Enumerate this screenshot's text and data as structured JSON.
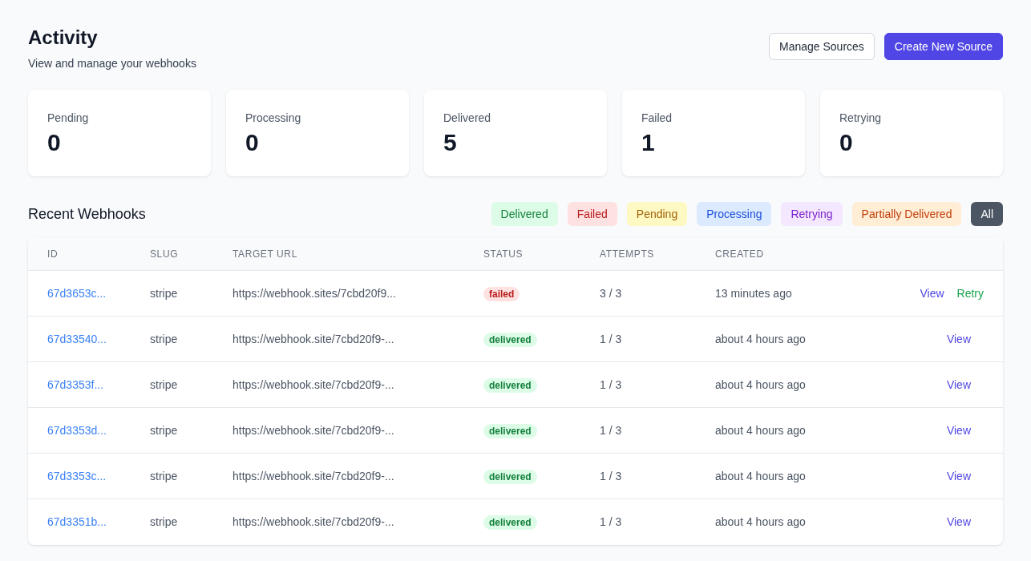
{
  "header": {
    "title": "Activity",
    "subtitle": "View and manage your webhooks",
    "buttons": [
      {
        "label": "Manage Sources",
        "kind": "secondary"
      },
      {
        "label": "Create New Source",
        "kind": "primary"
      }
    ]
  },
  "stats": [
    {
      "label": "Pending",
      "value": "0"
    },
    {
      "label": "Processing",
      "value": "0"
    },
    {
      "label": "Delivered",
      "value": "5"
    },
    {
      "label": "Failed",
      "value": "1"
    },
    {
      "label": "Retrying",
      "value": "0"
    }
  ],
  "recent": {
    "title": "Recent Webhooks",
    "filters": [
      {
        "label": "Delivered",
        "kind": "delivered",
        "selected": false
      },
      {
        "label": "Failed",
        "kind": "failed",
        "selected": false
      },
      {
        "label": "Pending",
        "kind": "pending",
        "selected": false
      },
      {
        "label": "Processing",
        "kind": "processing",
        "selected": false
      },
      {
        "label": "Retrying",
        "kind": "retrying",
        "selected": false
      },
      {
        "label": "Partially Delivered",
        "kind": "partial",
        "selected": false
      },
      {
        "label": "All",
        "kind": "all",
        "selected": true
      }
    ],
    "table": {
      "columns": [
        "ID",
        "SLUG",
        "TARGET URL",
        "STATUS",
        "ATTEMPTS",
        "CREATED"
      ],
      "rows": [
        {
          "id": "67d3653c...",
          "slug": "stripe",
          "target_url": "https://webhook.sites/7cbd20f9...",
          "status": {
            "label": "failed",
            "kind": "failed"
          },
          "attempts": "3 / 3",
          "created": "13 minutes ago",
          "actions": [
            {
              "label": "View",
              "kind": "view"
            },
            {
              "label": "Retry",
              "kind": "retry"
            }
          ]
        },
        {
          "id": "67d33540...",
          "slug": "stripe",
          "target_url": "https://webhook.site/7cbd20f9-...",
          "status": {
            "label": "delivered",
            "kind": "delivered"
          },
          "attempts": "1 / 3",
          "created": "about 4 hours ago",
          "actions": [
            {
              "label": "View",
              "kind": "view"
            }
          ]
        },
        {
          "id": "67d3353f...",
          "slug": "stripe",
          "target_url": "https://webhook.site/7cbd20f9-...",
          "status": {
            "label": "delivered",
            "kind": "delivered"
          },
          "attempts": "1 / 3",
          "created": "about 4 hours ago",
          "actions": [
            {
              "label": "View",
              "kind": "view"
            }
          ]
        },
        {
          "id": "67d3353d...",
          "slug": "stripe",
          "target_url": "https://webhook.site/7cbd20f9-...",
          "status": {
            "label": "delivered",
            "kind": "delivered"
          },
          "attempts": "1 / 3",
          "created": "about 4 hours ago",
          "actions": [
            {
              "label": "View",
              "kind": "view"
            }
          ]
        },
        {
          "id": "67d3353c...",
          "slug": "stripe",
          "target_url": "https://webhook.site/7cbd20f9-...",
          "status": {
            "label": "delivered",
            "kind": "delivered"
          },
          "attempts": "1 / 3",
          "created": "about 4 hours ago",
          "actions": [
            {
              "label": "View",
              "kind": "view"
            }
          ]
        },
        {
          "id": "67d3351b...",
          "slug": "stripe",
          "target_url": "https://webhook.site/7cbd20f9-...",
          "status": {
            "label": "delivered",
            "kind": "delivered"
          },
          "attempts": "1 / 3",
          "created": "about 4 hours ago",
          "actions": [
            {
              "label": "View",
              "kind": "view"
            }
          ]
        }
      ]
    }
  }
}
